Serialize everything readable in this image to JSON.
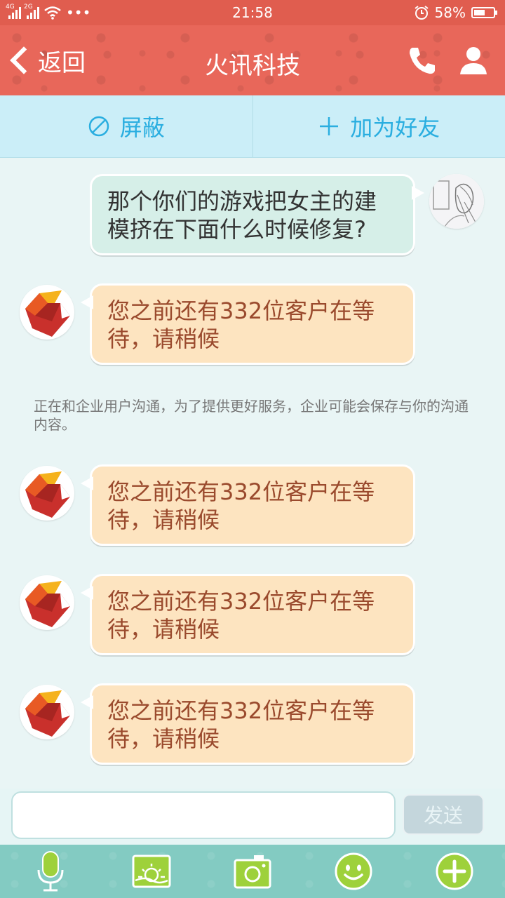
{
  "status_bar": {
    "net1": "4G",
    "net2": "2G",
    "dots": "•••",
    "time": "21:58",
    "battery_text": "58%",
    "battery_level": 0.58
  },
  "nav": {
    "back_label": "返回",
    "title": "火讯科技"
  },
  "actions": {
    "block_label": "屏蔽",
    "add_friend_label": "加为好友"
  },
  "messages": [
    {
      "type": "sent",
      "text": "那个你们的游戏把女主的建模挤在下面什么时候修复?"
    },
    {
      "type": "received",
      "text": "您之前还有332位客户在等待，请稍候"
    },
    {
      "type": "notice",
      "text": "正在和企业用户沟通，为了提供更好服务，企业可能会保存与你的沟通内容。"
    },
    {
      "type": "received",
      "text": "您之前还有332位客户在等待，请稍候"
    },
    {
      "type": "received",
      "text": "您之前还有332位客户在等待，请稍候"
    },
    {
      "type": "received",
      "text": "您之前还有332位客户在等待，请稍候"
    }
  ],
  "input": {
    "value": "",
    "placeholder": "",
    "send_label": "发送"
  },
  "toolbar": {
    "icons": [
      "microphone-icon",
      "image-icon",
      "camera-icon",
      "emoji-icon",
      "plus-icon"
    ]
  },
  "colors": {
    "header": "#e8675a",
    "action_bar": "#cbeef8",
    "accent_blue": "#2aaee0",
    "sent_bubble": "#d6efe8",
    "received_bubble": "#fde4c0",
    "toolbar": "#83cbc2"
  }
}
